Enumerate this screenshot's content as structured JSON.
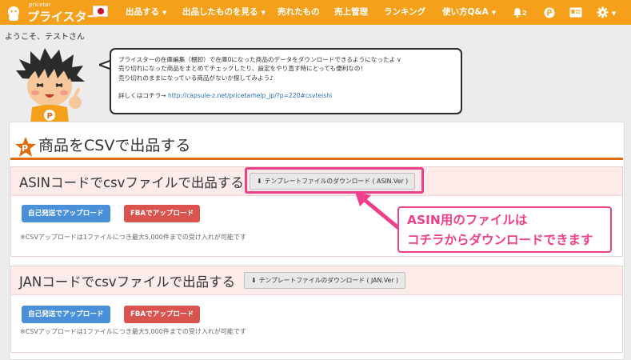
{
  "header": {
    "logo_small": "pricetar",
    "logo_big": "プライスター",
    "nav": [
      {
        "label": "出品する",
        "has_caret": true
      },
      {
        "label": "出品したものを見る",
        "has_caret": true
      },
      {
        "label": "売れたもの",
        "has_caret": false
      },
      {
        "label": "売上管理",
        "has_caret": false
      },
      {
        "label": "ランキング",
        "has_caret": false
      },
      {
        "label": "使い方Q&A",
        "has_caret": true
      }
    ],
    "caret": "▼",
    "notification_count": "2",
    "icons": [
      "bell-icon",
      "p-coin-icon",
      "id-card-icon",
      "gear-icon"
    ]
  },
  "welcome": "ようこそ、テストさん",
  "bubble": {
    "lines": [
      "プライスターの在庫編集（棚卸）で在庫0になった商品のデータをダウンロードできるようになったよ v",
      "売り切れになった商品をまとめてチェックしたり、設定をやり直す時にとっても便利なの！",
      "売り切れのままになっている商品がないか探してみよう♪"
    ],
    "detail_prefix": "詳しくはコチラ→ ",
    "detail_link": "http://capsule-z.net/pricetarhelp_jp/?p=220#csvteishi"
  },
  "page_title": "商品をCSVで出品する",
  "sections": [
    {
      "title": "ASINコードでcsvファイルで出品する",
      "template_button": "テンプレートファイルのダウンロード ( ASIN.Ver )",
      "self_button": "自己発送でアップロード",
      "fba_button": "FBAでアップロード",
      "note": "※CSVアップロードは1ファイルにつき最大5,000件までの受け入れが可能です"
    },
    {
      "title": "JANコードでcsvファイルで出品する",
      "template_button": "テンプレートファイルのダウンロード ( JAN.Ver )",
      "self_button": "自己発送でアップロード",
      "fba_button": "FBAでアップロード",
      "note": "※CSVアップロードは1ファイルにつき最大5,000件までの受け入れが可能です"
    }
  ],
  "callout": {
    "line1": "ASIN用のファイルは",
    "line2": "コチラからダウンロードできます"
  },
  "colors": {
    "nav_bg": "#f5a01a",
    "accent_rule": "#e06b0c",
    "section_head_bg": "#fcebe9",
    "blue_button": "#4a90d9",
    "red_button": "#d9534f",
    "annotation": "#ee3f8a"
  }
}
